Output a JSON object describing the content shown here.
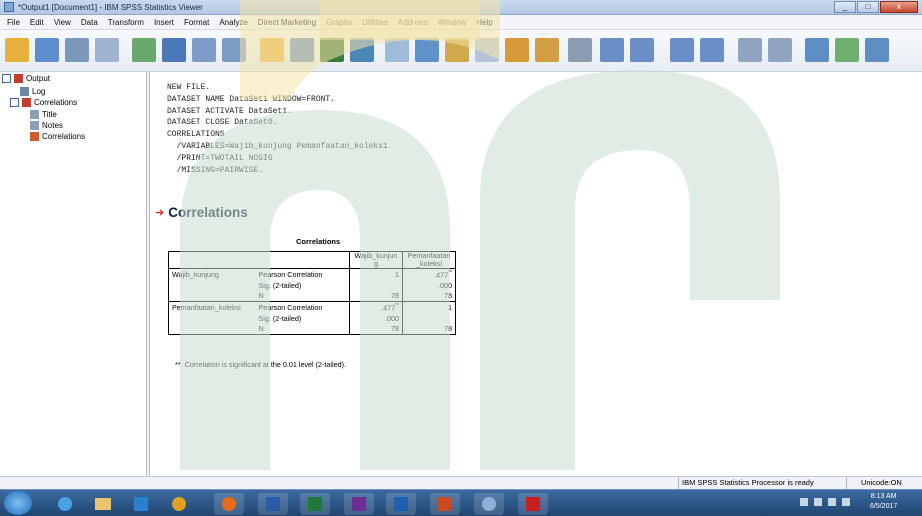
{
  "window": {
    "title": "*Output1 [Document1] - IBM SPSS Statistics Viewer",
    "buttons": {
      "min": "_",
      "max": "□",
      "close": "x"
    }
  },
  "menubar": {
    "items": [
      "File",
      "Edit",
      "View",
      "Data",
      "Transform",
      "Insert",
      "Format",
      "Analyze",
      "Direct Marketing",
      "Graphs",
      "Utilities",
      "Add-ons",
      "Window",
      "Help"
    ]
  },
  "toolbar": {
    "icons": [
      "open-icon",
      "save-icon",
      "print-icon",
      "print-preview-icon",
      "export-icon",
      "recall-dialog-icon",
      "undo-icon",
      "redo-icon",
      "goto-data-icon",
      "goto-case-icon",
      "goto-variable-icon",
      "variables-icon",
      "run-descriptives-icon",
      "pie-icon",
      "stop-icon",
      "split-icon",
      "weight-icon",
      "select-cases-icon",
      "labels-icon",
      "back-icon",
      "forward-icon",
      "expand-icon",
      "collapse-icon",
      "show-icon",
      "hide-icon",
      "insert-heading-icon",
      "insert-title-icon",
      "insert-text-icon"
    ]
  },
  "navigator": {
    "items": [
      {
        "label": "Output"
      },
      {
        "label": "Log"
      },
      {
        "label": "Correlations"
      },
      {
        "label": "Title"
      },
      {
        "label": "Notes"
      },
      {
        "label": "Correlations"
      }
    ]
  },
  "syntax": "NEW FILE.\nDATASET NAME DataSet1 WINDOW=FRONT.\nDATASET ACTIVATE DataSet1.\nDATASET CLOSE DataSet0.\nCORRELATIONS\n  /VARIABLES=Wajib_kunjung Pemanfaatan_koleksi\n  /PRINT=TWOTAIL NOSIG\n  /MISSING=PAIRWISE.",
  "section_heading": "Correlations",
  "table": {
    "title": "Correlations",
    "col1": "Wajib_kunjun\ng",
    "col2": "Pemanfaatan\n_koleksi",
    "rows": [
      {
        "var": "Wajib_kunjung",
        "stat": "Pearson Correlation",
        "v1": "1",
        "v2": "477",
        "v2_sup": "**"
      },
      {
        "var": "",
        "stat": "Sig. (2-tailed)",
        "v1": "",
        "v2": ".000"
      },
      {
        "var": "",
        "stat": "N",
        "v1": "78",
        "v2": "78"
      },
      {
        "var": "Pemanfaatan_koleksi",
        "stat": "Pearson Correlation",
        "v1": ".477",
        "v1_sup": "**",
        "v2": "1"
      },
      {
        "var": "",
        "stat": "Sig. (2-tailed)",
        "v1": ".000",
        "v2": ""
      },
      {
        "var": "",
        "stat": "N",
        "v1": "78",
        "v2": "78"
      }
    ],
    "footnote": "**. Correlation is significant at the 0.01 level (2-tailed)."
  },
  "statusbar": {
    "processor": "IBM SPSS Statistics Processor is ready",
    "unicode": "Unicode:ON"
  },
  "taskbar": {
    "apps": [
      "start-orb",
      "ie-icon",
      "explorer-icon",
      "media-player-icon",
      "chrome-icon",
      "firefox-icon",
      "word-icon",
      "excel-icon",
      "onenote-icon",
      "outlook-icon",
      "powerpoint-icon",
      "spss-icon",
      "acrobat-icon"
    ],
    "time": "8:13 AM",
    "date": "6/5/2017"
  },
  "colors": {
    "watermark_yellow": "#f2e4a8",
    "watermark_green": "#c8ddd0",
    "accent_red": "#d8282a"
  }
}
